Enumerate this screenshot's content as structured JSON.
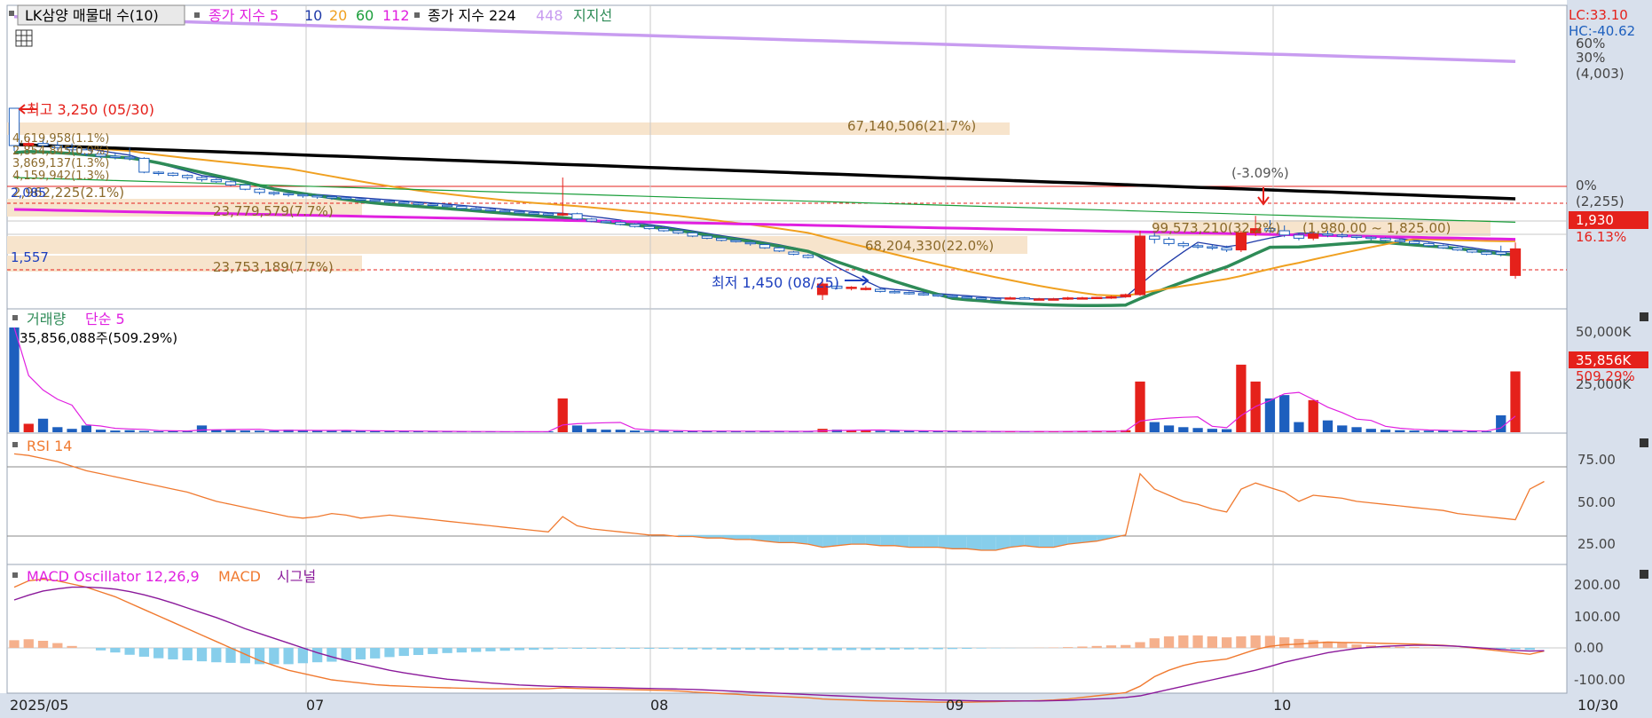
{
  "colors": {
    "background": "#ffffff",
    "axis_panel": "#d8e0ec",
    "grid": "#c8c8c8",
    "up": "#e5211b",
    "down": "#1d5fbe",
    "ma5": "#1f3aa8",
    "ma10": "#2e8b57",
    "ma20": "#f0a020",
    "ma60": "#1a9e3a",
    "ma112": "#e020e0",
    "ma224": "#000000",
    "ma448": "#c89cf0",
    "support": "#2e8b57",
    "volume_ma": "#e020e0",
    "rsi": "#f07a30",
    "rsi_fill": "#87ceeb",
    "macd": "#f07a30",
    "signal": "#8b1a9b",
    "osc_pos": "#f5b08c",
    "osc_neg": "#87ceeb",
    "profile": "#f7e4cc",
    "profile_text": "#8b6a2b"
  },
  "legend": {
    "price_main": "LK삼양 매물대 수(10)",
    "price_close_label": "종가 지수 5",
    "ma10": "10",
    "ma20": "20",
    "ma60": "60",
    "ma112": "112",
    "price_close_label2": "종가 지수 224",
    "ma448": "448",
    "support": "지지선",
    "volume_label": "거래량",
    "volume_ma_label": "단순 5",
    "volume_value": "35,856,088주(509.29%)",
    "rsi_label": "RSI 14",
    "macd_osc_label": "MACD Oscillator 12,26,9",
    "macd_label": "MACD",
    "signal_label": "시그널"
  },
  "annotations": {
    "high": "최고 3,250 (05/30)",
    "low": "최저 1,450 (08/25)",
    "left_price": "1,557",
    "left_price2": "2,085",
    "pct_marker": "(-3.09%)",
    "range_text": "(1,980.00 ~ 1,825.00)",
    "lc": "LC:33.10",
    "hc": "HC:-40.62"
  },
  "profile_labels": [
    "67,140,506(21.7%)",
    "23,779,579(7.7%)",
    "23,753,189(7.7%)",
    "68,204,330(22.0%)",
    "99,573,210(32.2%)",
    "2,962,225(2.1%)",
    "4,619,958(1.1%)",
    "2,854,845(0.9%)",
    "3,869,137(1.3%)",
    "4,159,942(1.3%)"
  ],
  "right_axis": {
    "price": [
      "60%",
      "30%",
      "(4,003)",
      "0%",
      "(2,255)"
    ],
    "current_price": "1,930",
    "current_pct": "16.13%",
    "volume": [
      "50,000K",
      "25,000K"
    ],
    "volume_current": "35,856K",
    "volume_pct": "509.29%",
    "rsi": [
      "75.00",
      "50.00",
      "25.00"
    ],
    "macd": [
      "200.00",
      "100.00",
      "0.00",
      "-100.00"
    ]
  },
  "x_axis": {
    "labels": [
      "2025/05",
      "07",
      "08",
      "09",
      "10"
    ],
    "right_label": "10/30"
  },
  "chart_data": {
    "type": "candlestick",
    "range": "2025/05 – 10/30",
    "price_ylim": [
      1350,
      4200
    ],
    "candles": [
      [
        3250,
        3250,
        2850,
        2900
      ],
      [
        2900,
        2960,
        2880,
        2920
      ],
      [
        2920,
        2960,
        2880,
        2900
      ],
      [
        2900,
        2940,
        2860,
        2880
      ],
      [
        2880,
        2920,
        2840,
        2860
      ],
      [
        2860,
        2880,
        2800,
        2820
      ],
      [
        2820,
        2850,
        2780,
        2800
      ],
      [
        2800,
        2830,
        2770,
        2790
      ],
      [
        2790,
        2880,
        2760,
        2780
      ],
      [
        2780,
        2790,
        2640,
        2650
      ],
      [
        2650,
        2660,
        2620,
        2640
      ],
      [
        2640,
        2650,
        2610,
        2620
      ],
      [
        2620,
        2630,
        2580,
        2600
      ],
      [
        2600,
        2610,
        2560,
        2580
      ],
      [
        2580,
        2590,
        2550,
        2560
      ],
      [
        2560,
        2570,
        2520,
        2530
      ],
      [
        2530,
        2540,
        2480,
        2490
      ],
      [
        2490,
        2500,
        2440,
        2460
      ],
      [
        2460,
        2470,
        2430,
        2450
      ],
      [
        2450,
        2460,
        2420,
        2440
      ],
      [
        2440,
        2450,
        2410,
        2430
      ],
      [
        2430,
        2440,
        2400,
        2420
      ],
      [
        2420,
        2430,
        2390,
        2410
      ],
      [
        2410,
        2420,
        2390,
        2400
      ],
      [
        2400,
        2410,
        2380,
        2390
      ],
      [
        2390,
        2400,
        2370,
        2380
      ],
      [
        2380,
        2390,
        2360,
        2370
      ],
      [
        2370,
        2380,
        2350,
        2360
      ],
      [
        2360,
        2370,
        2340,
        2350
      ],
      [
        2350,
        2360,
        2330,
        2340
      ],
      [
        2340,
        2350,
        2320,
        2330
      ],
      [
        2330,
        2340,
        2300,
        2310
      ],
      [
        2310,
        2320,
        2290,
        2300
      ],
      [
        2300,
        2310,
        2280,
        2290
      ],
      [
        2290,
        2300,
        2270,
        2280
      ],
      [
        2280,
        2290,
        2260,
        2270
      ],
      [
        2270,
        2280,
        2250,
        2260
      ],
      [
        2260,
        2270,
        2240,
        2250
      ],
      [
        2250,
        2600,
        2240,
        2260
      ],
      [
        2260,
        2270,
        2200,
        2210
      ],
      [
        2210,
        2220,
        2180,
        2190
      ],
      [
        2190,
        2200,
        2170,
        2180
      ],
      [
        2180,
        2190,
        2150,
        2160
      ],
      [
        2160,
        2170,
        2130,
        2140
      ],
      [
        2140,
        2150,
        2110,
        2120
      ],
      [
        2120,
        2130,
        2090,
        2100
      ],
      [
        2100,
        2110,
        2070,
        2080
      ],
      [
        2080,
        2090,
        2040,
        2050
      ],
      [
        2050,
        2060,
        2020,
        2030
      ],
      [
        2030,
        2040,
        2000,
        2010
      ],
      [
        2010,
        2020,
        1990,
        2000
      ],
      [
        1990,
        2000,
        1960,
        1980
      ],
      [
        1970,
        1980,
        1930,
        1940
      ],
      [
        1940,
        1950,
        1900,
        1910
      ],
      [
        1900,
        1910,
        1870,
        1880
      ],
      [
        1870,
        1880,
        1840,
        1850
      ],
      [
        1500,
        1640,
        1450,
        1600
      ],
      [
        1580,
        1620,
        1550,
        1560
      ],
      [
        1560,
        1580,
        1540,
        1570
      ],
      [
        1560,
        1580,
        1540,
        1560
      ],
      [
        1550,
        1560,
        1520,
        1530
      ],
      [
        1530,
        1540,
        1510,
        1520
      ],
      [
        1520,
        1530,
        1500,
        1510
      ],
      [
        1510,
        1520,
        1490,
        1500
      ],
      [
        1500,
        1510,
        1480,
        1490
      ],
      [
        1490,
        1500,
        1470,
        1480
      ],
      [
        1480,
        1490,
        1460,
        1470
      ],
      [
        1470,
        1480,
        1450,
        1460
      ],
      [
        1460,
        1470,
        1440,
        1450
      ],
      [
        1470,
        1480,
        1460,
        1470
      ],
      [
        1470,
        1480,
        1460,
        1460
      ],
      [
        1460,
        1470,
        1450,
        1460
      ],
      [
        1460,
        1470,
        1450,
        1460
      ],
      [
        1460,
        1480,
        1450,
        1470
      ],
      [
        1470,
        1480,
        1460,
        1470
      ],
      [
        1470,
        1480,
        1460,
        1475
      ],
      [
        1475,
        1490,
        1460,
        1480
      ],
      [
        1480,
        1510,
        1470,
        1500
      ],
      [
        1500,
        2100,
        1490,
        2050
      ],
      [
        2050,
        2080,
        1980,
        2020
      ],
      [
        2020,
        2040,
        1960,
        1980
      ],
      [
        1980,
        2000,
        1940,
        1960
      ],
      [
        1960,
        1980,
        1930,
        1950
      ],
      [
        1950,
        1970,
        1920,
        1940
      ],
      [
        1940,
        1960,
        1900,
        1920
      ],
      [
        1920,
        2100,
        1900,
        2080
      ],
      [
        2080,
        2240,
        2050,
        2120
      ],
      [
        2120,
        2200,
        2080,
        2100
      ],
      [
        2100,
        2150,
        2040,
        2060
      ],
      [
        2060,
        2080,
        2010,
        2030
      ],
      [
        2030,
        2090,
        2010,
        2070
      ],
      [
        2070,
        2100,
        2040,
        2060
      ],
      [
        2060,
        2080,
        2030,
        2050
      ],
      [
        2050,
        2060,
        2020,
        2040
      ],
      [
        2040,
        2050,
        2010,
        2030
      ],
      [
        2030,
        2040,
        2000,
        2010
      ],
      [
        2010,
        2020,
        1980,
        2000
      ],
      [
        2000,
        2010,
        1970,
        1980
      ],
      [
        1980,
        1990,
        1950,
        1960
      ],
      [
        1960,
        1970,
        1930,
        1940
      ],
      [
        1940,
        1950,
        1910,
        1920
      ],
      [
        1920,
        1930,
        1890,
        1900
      ],
      [
        1900,
        1910,
        1870,
        1880
      ],
      [
        1900,
        1960,
        1860,
        1880
      ],
      [
        1680,
        1990,
        1650,
        1930
      ]
    ],
    "volume_k": [
      62000,
      5000,
      8000,
      3000,
      2000,
      4000,
      1500,
      1000,
      1200,
      800,
      600,
      700,
      500,
      4000,
      1500,
      1200,
      1000,
      900,
      800,
      1500,
      1200,
      900,
      800,
      1000,
      900,
      700,
      600,
      500,
      600,
      400,
      500,
      400,
      300,
      400,
      300,
      400,
      300,
      500,
      20000,
      4000,
      2000,
      1500,
      1500,
      1000,
      800,
      700,
      600,
      700,
      600,
      700,
      600,
      500,
      600,
      500,
      400,
      500,
      2000,
      1500,
      1200,
      1000,
      800,
      900,
      800,
      700,
      600,
      500,
      400,
      500,
      400,
      500,
      400,
      500,
      400,
      600,
      800,
      700,
      500,
      1200,
      30000,
      6000,
      4000,
      3000,
      2500,
      2000,
      1800,
      40000,
      30000,
      20000,
      22000,
      6000,
      19000,
      7000,
      4000,
      3000,
      2000,
      1500,
      1200,
      1000,
      900,
      800,
      700,
      600,
      500,
      10000,
      36000
    ],
    "rsi": [
      83,
      82,
      80,
      78,
      75,
      72,
      70,
      68,
      66,
      64,
      62,
      60,
      58,
      55,
      52,
      50,
      48,
      46,
      44,
      42,
      41,
      42,
      44,
      43,
      41,
      42,
      43,
      42,
      41,
      40,
      39,
      38,
      37,
      36,
      35,
      34,
      33,
      32,
      42,
      36,
      34,
      33,
      32,
      31,
      30,
      30,
      29,
      29,
      28,
      28,
      27,
      27,
      26,
      25,
      25,
      24,
      22,
      23,
      24,
      24,
      23,
      23,
      22,
      22,
      22,
      21,
      21,
      20,
      20,
      22,
      23,
      22,
      22,
      24,
      25,
      26,
      28,
      30,
      70,
      60,
      56,
      52,
      50,
      47,
      45,
      60,
      64,
      61,
      58,
      52,
      56,
      55,
      54,
      52,
      51,
      50,
      49,
      48,
      47,
      46,
      44,
      43,
      42,
      41,
      40,
      60,
      65
    ],
    "macd": [
      190,
      210,
      215,
      210,
      200,
      190,
      175,
      160,
      140,
      120,
      100,
      80,
      60,
      40,
      20,
      0,
      -20,
      -40,
      -55,
      -70,
      -80,
      -90,
      -100,
      -105,
      -110,
      -115,
      -118,
      -120,
      -122,
      -124,
      -125,
      -126,
      -127,
      -128,
      -128,
      -128,
      -128,
      -128,
      -125,
      -127,
      -128,
      -129,
      -130,
      -131,
      -132,
      -133,
      -135,
      -138,
      -140,
      -143,
      -145,
      -148,
      -150,
      -152,
      -154,
      -156,
      -160,
      -162,
      -163,
      -165,
      -166,
      -167,
      -168,
      -169,
      -170,
      -170,
      -170,
      -169,
      -168,
      -167,
      -166,
      -165,
      -163,
      -160,
      -155,
      -150,
      -145,
      -140,
      -120,
      -90,
      -70,
      -55,
      -45,
      -40,
      -35,
      -20,
      -5,
      5,
      10,
      12,
      15,
      18,
      17,
      16,
      15,
      14,
      13,
      12,
      10,
      8,
      5,
      0,
      -5,
      -10,
      -15,
      -20,
      -10
    ],
    "signal": [
      150,
      165,
      178,
      185,
      190,
      190,
      188,
      184,
      176,
      166,
      154,
      140,
      125,
      110,
      95,
      78,
      60,
      45,
      30,
      15,
      0,
      -15,
      -28,
      -40,
      -50,
      -60,
      -70,
      -78,
      -85,
      -92,
      -98,
      -102,
      -106,
      -110,
      -113,
      -116,
      -118,
      -120,
      -121,
      -122,
      -123,
      -124,
      -125,
      -126,
      -127,
      -128,
      -129,
      -130,
      -132,
      -134,
      -136,
      -138,
      -140,
      -142,
      -144,
      -146,
      -148,
      -150,
      -152,
      -154,
      -156,
      -158,
      -160,
      -162,
      -163,
      -164,
      -165,
      -166,
      -166,
      -166,
      -166,
      -166,
      -165,
      -164,
      -162,
      -160,
      -158,
      -155,
      -150,
      -140,
      -130,
      -120,
      -110,
      -100,
      -90,
      -80,
      -70,
      -58,
      -45,
      -35,
      -25,
      -15,
      -8,
      -2,
      2,
      5,
      7,
      8,
      8,
      7,
      5,
      2,
      -1,
      -5,
      -8,
      -10,
      -9
    ]
  }
}
